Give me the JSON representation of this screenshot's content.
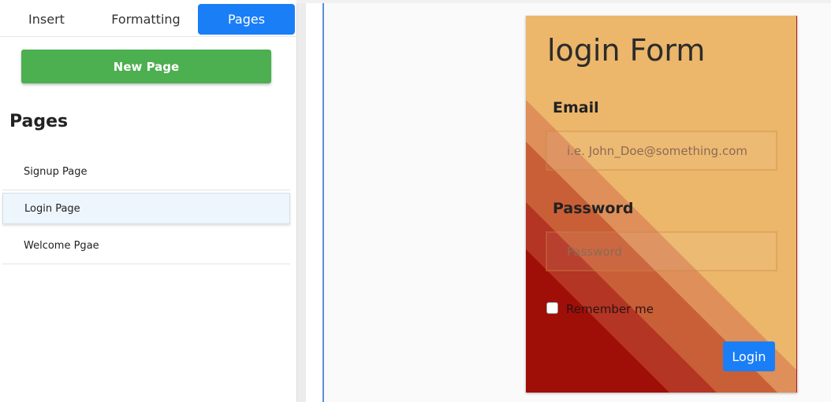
{
  "tabs": {
    "insert": "Insert",
    "formatting": "Formatting",
    "pages": "Pages"
  },
  "sidebar": {
    "new_page_label": "New Page",
    "pages_heading": "Pages",
    "pages": [
      "Signup Page",
      "Login Page",
      "Welcome Pgae"
    ],
    "selected_page": "Login Page"
  },
  "canvas": {
    "form_title": "login Form",
    "email_label": "Email",
    "email_placeholder": "i.e. John_Doe@something.com",
    "password_label": "Password",
    "password_placeholder": "Password",
    "remember_label": "Remember me",
    "login_label": "Login"
  },
  "colors": {
    "accent": "#1a7ef7",
    "new_page_green": "#4caf50",
    "card_orange": "#ecb66b",
    "card_dark_red": "#a00e08"
  }
}
